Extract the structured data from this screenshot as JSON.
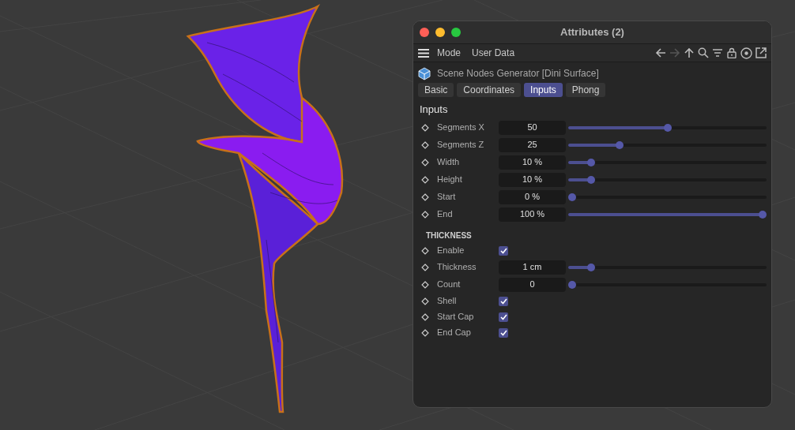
{
  "window": {
    "title": "Attributes (2)"
  },
  "menu": [
    "Mode",
    "User Data"
  ],
  "object": {
    "name": "Scene Nodes Generator [Dini Surface]"
  },
  "tabs": [
    {
      "label": "Basic",
      "selected": false
    },
    {
      "label": "Coordinates",
      "selected": false
    },
    {
      "label": "Inputs",
      "selected": true
    },
    {
      "label": "Phong",
      "selected": false
    }
  ],
  "section": "Inputs",
  "inputs": [
    {
      "kind": "slider",
      "label": "Segments X",
      "value": "50",
      "level": 0.5
    },
    {
      "kind": "slider",
      "label": "Segments Z",
      "value": "25",
      "level": 0.25
    },
    {
      "kind": "slider",
      "label": "Width",
      "value": "10 %",
      "level": 0.1
    },
    {
      "kind": "slider",
      "label": "Height",
      "value": "10 %",
      "level": 0.1
    },
    {
      "kind": "slider",
      "label": "Start",
      "value": "0 %",
      "level": 0
    },
    {
      "kind": "slider",
      "label": "End",
      "value": "100 %",
      "level": 1
    }
  ],
  "group": "THICKNESS",
  "thickness": [
    {
      "kind": "checkbox",
      "label": "Enable",
      "checked": true
    },
    {
      "kind": "slider",
      "label": "Thickness",
      "value": "1 cm",
      "level": 0.1
    },
    {
      "kind": "slider",
      "label": "Count",
      "value": "0",
      "level": 0
    },
    {
      "kind": "checkbox",
      "label": "Shell",
      "checked": true
    },
    {
      "kind": "checkbox",
      "label": "Start Cap",
      "checked": true
    },
    {
      "kind": "checkbox",
      "label": "End Cap",
      "checked": true
    }
  ]
}
